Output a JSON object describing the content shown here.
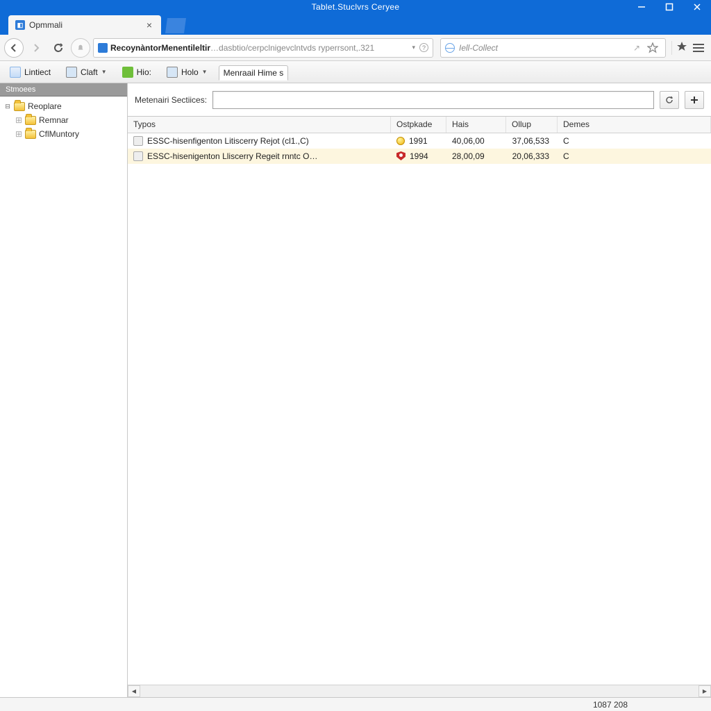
{
  "window": {
    "title": "Tablet.Stuclvrs Ceryee"
  },
  "tab": {
    "title": "Opmmali"
  },
  "addressbar": {
    "url_dark": "RecoynàntorMenentileltir",
    "url_light": "…dasbtio/cerpclnigevclntvds ryperrsont,.321",
    "search_placeholder": "Iell-Collect"
  },
  "bookmarks": [
    {
      "label": "Lintiect",
      "icon": "page",
      "dropdown": false
    },
    {
      "label": "Claft",
      "icon": "monitor",
      "dropdown": true
    },
    {
      "label": "Hio:",
      "icon": "green",
      "dropdown": false
    },
    {
      "label": "Holo",
      "icon": "monitor",
      "dropdown": true
    },
    {
      "label": "Menraail Hime  s",
      "icon": "none",
      "dropdown": false,
      "active": true
    }
  ],
  "sidebar": {
    "header": "Stmoees",
    "tree": [
      {
        "label": "Reoplare",
        "level": 0,
        "expanded": true
      },
      {
        "label": "Remnar",
        "level": 1
      },
      {
        "label": "CflMuntory",
        "level": 1
      }
    ]
  },
  "filter": {
    "label": "Metenairi Sectiices:",
    "value": ""
  },
  "table": {
    "columns": [
      "Typos",
      "Ostpkade",
      "Hais",
      "Ollup",
      "Demes"
    ],
    "rows": [
      {
        "name": "ESSC-hisenfigenton Litiscerry Rejot (cl1.,C)",
        "icon": "bulb",
        "ost": "1991",
        "hais": "40,06,00",
        "ollup": "37,06,533",
        "demes": "C",
        "selected": false
      },
      {
        "name": "ESSC-hisenigenton Lliscerry Regeit rnntc O…",
        "icon": "shield",
        "ost": "1994",
        "hais": "28,00,09",
        "ollup": "20,06,333",
        "demes": "C",
        "selected": true
      }
    ]
  },
  "status": {
    "text": "1087 208"
  }
}
